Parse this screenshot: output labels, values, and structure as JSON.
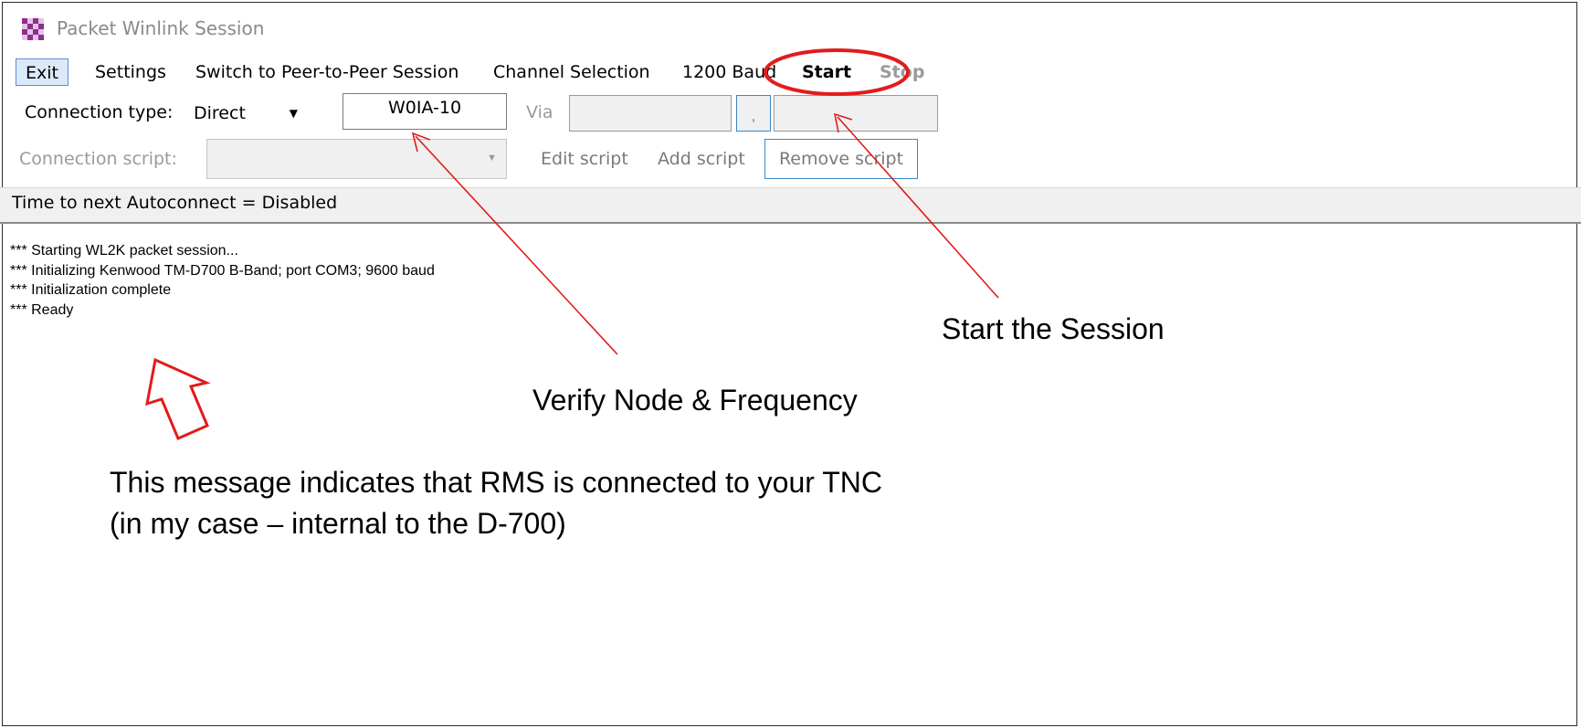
{
  "window": {
    "title": "Packet Winlink Session",
    "icon": "checkered-app-icon"
  },
  "menu": {
    "exit": "Exit",
    "settings": "Settings",
    "switch_p2p": "Switch to Peer-to-Peer Session",
    "channel_selection": "Channel Selection",
    "baud": "1200 Baud",
    "start": "Start",
    "stop": "Stop"
  },
  "connection": {
    "type_label": "Connection type:",
    "type_value": "Direct",
    "callsign": "W0IA-10",
    "via_label": "Via",
    "via_separator": ","
  },
  "script": {
    "label": "Connection script:",
    "edit": "Edit script",
    "add": "Add script",
    "remove": "Remove script"
  },
  "status": {
    "autoconnect": "Time to next Autoconnect = Disabled"
  },
  "log": [
    "*** Starting WL2K packet session...",
    "*** Initializing Kenwood TM-D700 B-Band; port COM3; 9600 baud",
    "*** Initialization complete",
    "*** Ready"
  ],
  "annotations": {
    "start_session": "Start the Session",
    "verify": "Verify Node & Frequency",
    "tnc_line1": "This message indicates that RMS is connected to your TNC",
    "tnc_line2": "(in my case – internal to the D-700)"
  },
  "colors": {
    "annotation": "#e31b1b",
    "icon_purple": "#8c2f8c",
    "icon_light": "#e6c3e6"
  }
}
